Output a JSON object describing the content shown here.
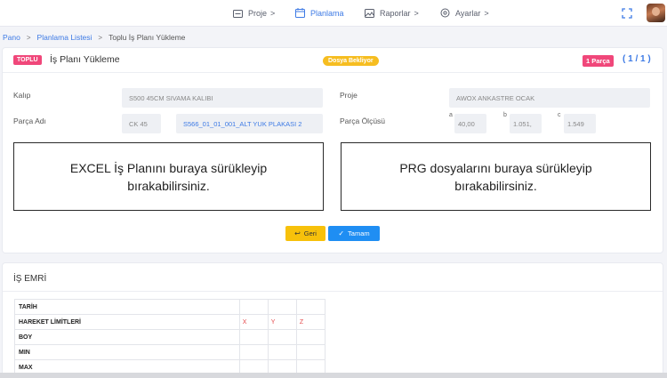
{
  "nav": {
    "items": [
      {
        "label": "Proje",
        "chevron": ">"
      },
      {
        "label": "Planlama",
        "chevron": ""
      },
      {
        "label": "Raporlar",
        "chevron": ">"
      },
      {
        "label": "Ayarlar",
        "chevron": ">"
      }
    ],
    "active_color": "#3d7ae5"
  },
  "breadcrumb": {
    "items": [
      "Pano",
      "Planlama Listesi",
      "Toplu İş Planı Yükleme"
    ],
    "separator": ">"
  },
  "header": {
    "badge": "TOPLU",
    "title": "İş Planı Yükleme",
    "status": "Dosya Bekliyor",
    "parca_badge": "1 Parça",
    "pager": "( 1 / 1 )"
  },
  "form": {
    "kalip_label": "Kalıp",
    "kalip_value": "S500 45CM SIVAMA KALIBI",
    "proje_label": "Proje",
    "proje_value": "AWOX ANKASTRE OCAK",
    "parca_adi_label": "Parça Adı",
    "parca_code": "CK 45",
    "parca_name": "S566_01_01_001_ALT YUK PLAKASI 2",
    "parca_olcusu_label": "Parça Ölçüsü",
    "dim_a_label": "a",
    "dim_a_value": "40,00",
    "dim_b_label": "b",
    "dim_b_value": "1.051,",
    "dim_c_label": "c",
    "dim_c_value": "1.549"
  },
  "dropzones": {
    "excel_line1": "EXCEL İş Planını buraya sürükleyip",
    "excel_line2": "bırakabilirsiniz.",
    "prg_line1": "PRG dosyalarını buraya sürükleyip",
    "prg_line2": "bırakabilirsiniz."
  },
  "buttons": {
    "back": "Geri",
    "ok": "Tamam"
  },
  "is_emri": {
    "title": "İŞ EMRİ",
    "rows": [
      {
        "label": "TARİH",
        "x": "",
        "y": "",
        "z": ""
      },
      {
        "label": "HAREKET LİMİTLERİ",
        "x": "X",
        "y": "Y",
        "z": "Z"
      },
      {
        "label": "BOY",
        "x": "",
        "y": "",
        "z": ""
      },
      {
        "label": "MIN",
        "x": "",
        "y": "",
        "z": ""
      },
      {
        "label": "MAX",
        "x": "",
        "y": "",
        "z": ""
      }
    ]
  },
  "colors": {
    "pink": "#f0477a",
    "yellow": "#f6bd20",
    "blue": "#1f8ef3"
  },
  "icons": [
    "folder-icon",
    "calendar-icon",
    "image-icon",
    "settings-icon",
    "expand-icon",
    "back-arrow-icon",
    "check-icon"
  ]
}
